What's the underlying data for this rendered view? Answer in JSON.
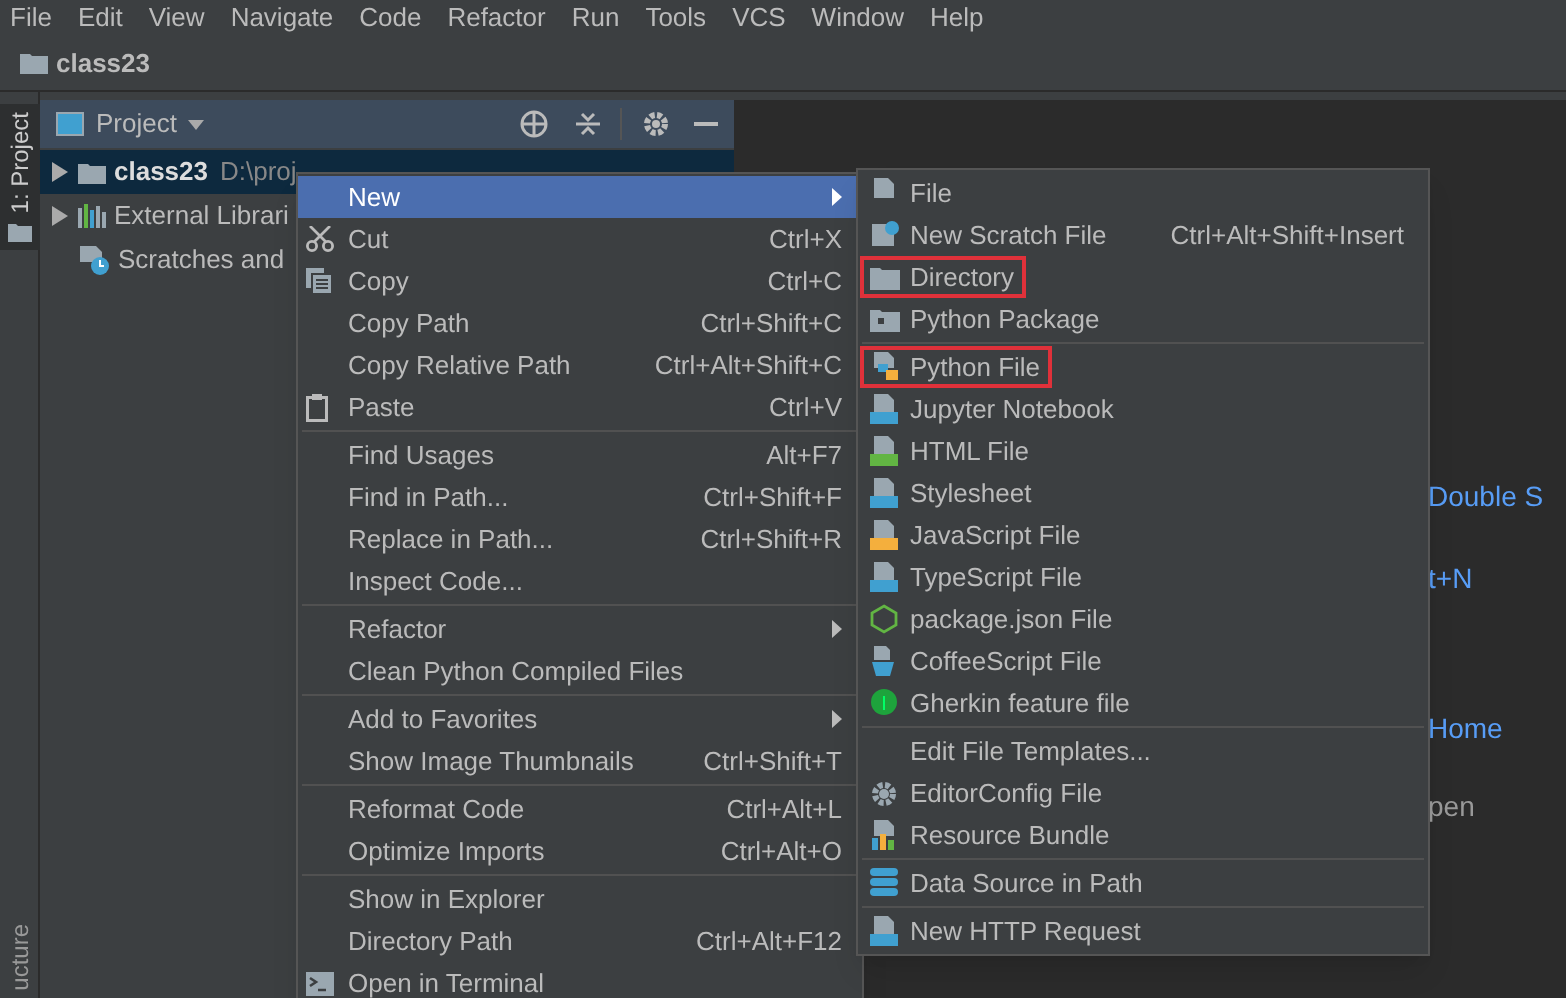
{
  "menu_bar": [
    "File",
    "Edit",
    "View",
    "Navigate",
    "Code",
    "Refactor",
    "Run",
    "Tools",
    "VCS",
    "Window",
    "Help"
  ],
  "nav_bar": {
    "breadcrumb": "class23"
  },
  "left_strip": {
    "tabs": [
      {
        "label": "1: Project",
        "selected": true
      },
      {
        "label": "ucture",
        "selected": false
      }
    ]
  },
  "project_panel": {
    "title": "Project",
    "tree": [
      {
        "label": "class23",
        "path": "D:\\proj",
        "kind": "folder",
        "expanded": false,
        "selected": true
      },
      {
        "label": "External Librari",
        "kind": "library",
        "expanded": false,
        "selected": false
      },
      {
        "label": "Scratches and",
        "kind": "scratches",
        "selected": false
      }
    ]
  },
  "editor_hints": [
    {
      "text": "Double S",
      "kind": "link"
    },
    {
      "text": "t+N",
      "kind": "link"
    },
    {
      "text": "Home",
      "kind": "link"
    },
    {
      "text": "pen",
      "kind": "plain"
    }
  ],
  "context_menu": {
    "groups": [
      [
        {
          "label": "New",
          "submenu": true,
          "selected": true,
          "kind": "plain"
        },
        {
          "label": "Cut",
          "shortcut": "Ctrl+X",
          "submenu": false,
          "selected": false,
          "kind": "cut"
        },
        {
          "label": "Copy",
          "shortcut": "Ctrl+C",
          "submenu": false,
          "selected": false,
          "kind": "copy"
        },
        {
          "label": "Copy Path",
          "shortcut": "Ctrl+Shift+C",
          "submenu": false,
          "selected": false,
          "kind": "plain"
        },
        {
          "label": "Copy Relative Path",
          "shortcut": "Ctrl+Alt+Shift+C",
          "submenu": false,
          "selected": false,
          "kind": "plain"
        },
        {
          "label": "Paste",
          "shortcut": "Ctrl+V",
          "submenu": false,
          "selected": false,
          "kind": "paste"
        }
      ],
      [
        {
          "label": "Find Usages",
          "shortcut": "Alt+F7",
          "submenu": false,
          "selected": false,
          "kind": "plain"
        },
        {
          "label": "Find in Path...",
          "shortcut": "Ctrl+Shift+F",
          "submenu": false,
          "selected": false,
          "kind": "plain"
        },
        {
          "label": "Replace in Path...",
          "shortcut": "Ctrl+Shift+R",
          "submenu": false,
          "selected": false,
          "kind": "plain"
        },
        {
          "label": "Inspect Code...",
          "submenu": false,
          "selected": false,
          "kind": "plain"
        }
      ],
      [
        {
          "label": "Refactor",
          "submenu": true,
          "selected": false,
          "kind": "plain"
        },
        {
          "label": "Clean Python Compiled Files",
          "submenu": false,
          "selected": false,
          "kind": "plain"
        }
      ],
      [
        {
          "label": "Add to Favorites",
          "submenu": true,
          "selected": false,
          "kind": "plain"
        },
        {
          "label": "Show Image Thumbnails",
          "shortcut": "Ctrl+Shift+T",
          "submenu": false,
          "selected": false,
          "kind": "plain"
        }
      ],
      [
        {
          "label": "Reformat Code",
          "shortcut": "Ctrl+Alt+L",
          "submenu": false,
          "selected": false,
          "kind": "plain"
        },
        {
          "label": "Optimize Imports",
          "shortcut": "Ctrl+Alt+O",
          "submenu": false,
          "selected": false,
          "kind": "plain"
        }
      ],
      [
        {
          "label": "Show in Explorer",
          "submenu": false,
          "selected": false,
          "kind": "plain"
        },
        {
          "label": "Directory Path",
          "shortcut": "Ctrl+Alt+F12",
          "submenu": false,
          "selected": false,
          "kind": "plain"
        },
        {
          "label": "Open in Terminal",
          "submenu": false,
          "selected": false,
          "kind": "terminal"
        }
      ]
    ]
  },
  "new_submenu": {
    "groups": [
      [
        {
          "label": "File",
          "kind": "file",
          "highlighted": false
        },
        {
          "label": "New Scratch File",
          "shortcut": "Ctrl+Alt+Shift+Insert",
          "kind": "scratch",
          "highlighted": false
        },
        {
          "label": "Directory",
          "kind": "folder",
          "highlighted": true
        },
        {
          "label": "Python Package",
          "kind": "package",
          "highlighted": false
        }
      ],
      [
        {
          "label": "Python File",
          "kind": "python",
          "highlighted": true
        },
        {
          "label": "Jupyter Notebook",
          "kind": "jupyter",
          "highlighted": false
        },
        {
          "label": "HTML File",
          "kind": "html",
          "highlighted": false
        },
        {
          "label": "Stylesheet",
          "kind": "css",
          "highlighted": false
        },
        {
          "label": "JavaScript File",
          "kind": "js",
          "highlighted": false
        },
        {
          "label": "TypeScript File",
          "kind": "ts",
          "highlighted": false
        },
        {
          "label": "package.json File",
          "kind": "node",
          "highlighted": false
        },
        {
          "label": "CoffeeScript File",
          "kind": "coffee",
          "highlighted": false
        },
        {
          "label": "Gherkin feature file",
          "kind": "gherkin",
          "highlighted": false
        }
      ],
      [
        {
          "label": "Edit File Templates...",
          "kind": "plain",
          "highlighted": false
        },
        {
          "label": "EditorConfig File",
          "kind": "gear",
          "highlighted": false
        },
        {
          "label": "Resource Bundle",
          "kind": "bundle",
          "highlighted": false
        }
      ],
      [
        {
          "label": "Data Source in Path",
          "kind": "database",
          "highlighted": false
        }
      ],
      [
        {
          "label": "New HTTP Request",
          "kind": "api",
          "highlighted": false
        }
      ]
    ]
  }
}
